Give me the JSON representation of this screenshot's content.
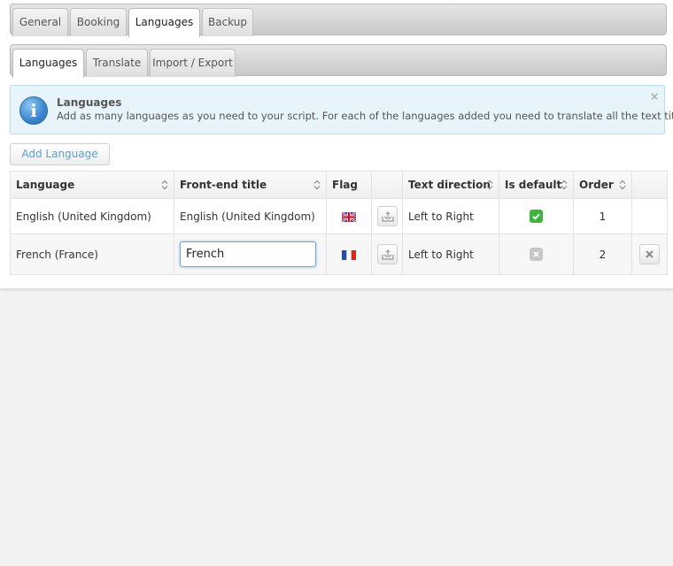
{
  "main_tabs": [
    {
      "label": "General"
    },
    {
      "label": "Booking"
    },
    {
      "label": "Languages"
    },
    {
      "label": "Backup"
    }
  ],
  "sub_tabs": [
    {
      "label": "Languages"
    },
    {
      "label": "Translate"
    },
    {
      "label": "Import / Export"
    }
  ],
  "notice": {
    "title": "Languages",
    "text": "Add as many languages as you need to your script. For each of the languages added you need to translate all the text titles.",
    "close": "×"
  },
  "add_button": "Add Language",
  "table": {
    "headers": [
      "Language",
      "Front-end title",
      "Flag",
      "",
      "Text direction",
      "Is default",
      "Order",
      ""
    ],
    "rows": [
      {
        "language": "English (United Kingdom)",
        "title": "English (United Kingdom)",
        "flag": "uk-flag-icon",
        "direction": "Left to Right",
        "is_default": true,
        "order": "1"
      },
      {
        "language": "French (France)",
        "title": "French",
        "flag": "france-flag-icon",
        "direction": "Left to Right",
        "is_default": false,
        "order": "2"
      }
    ]
  },
  "colors": {
    "accent": "#5aa3c8",
    "check_green": "#3fb33f",
    "info_bg": "#e7f4fa"
  }
}
